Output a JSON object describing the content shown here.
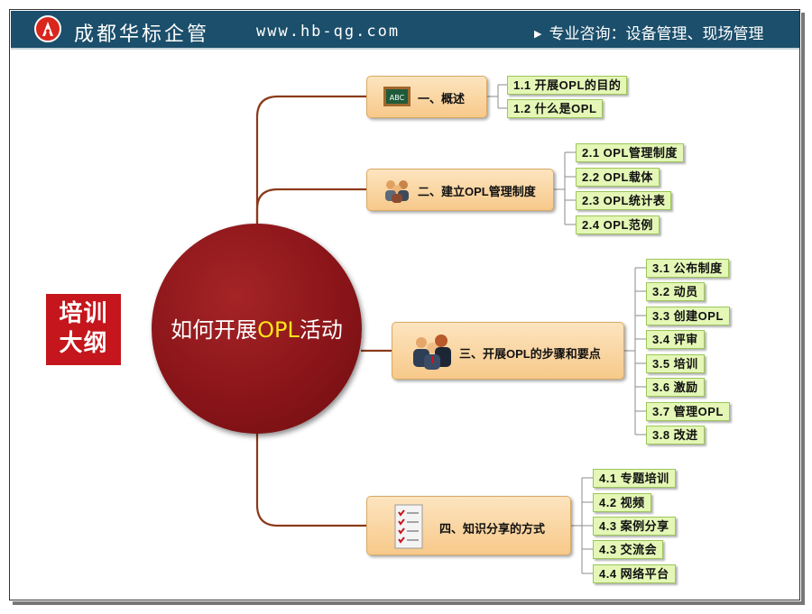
{
  "header": {
    "brand": "成都华标企管",
    "website": "www.hb-qg.com",
    "consult": "专业咨询：设备管理、现场管理"
  },
  "badge": {
    "line1": "培训",
    "line2": "大纲"
  },
  "center": {
    "title_prefix": "如何开展",
    "title_highlight": "OPL",
    "title_suffix": "活动"
  },
  "branches": [
    {
      "label": "一、概述",
      "icon": "abc-blackboard-icon",
      "items": [
        "1.1 开展OPL的目的",
        "1.2 什么是OPL"
      ]
    },
    {
      "label": "二、建立OPL管理制度",
      "icon": "team-icon",
      "items": [
        "2.1 OPL管理制度",
        "2.2 OPL载体",
        "2.3 OPL统计表",
        "2.4 OPL范例"
      ]
    },
    {
      "label": "三、开展OPL的步骤和要点",
      "icon": "business-people-icon",
      "items": [
        "3.1 公布制度",
        "3.2 动员",
        "3.3 创建OPL",
        "3.4 评审",
        "3.5 培训",
        "3.6 激励",
        "3.7 管理OPL",
        "3.8 改进"
      ]
    },
    {
      "label": "四、知识分享的方式",
      "icon": "checklist-icon",
      "items": [
        "4.1 专题培训",
        "4.2 视频",
        "4.3 案例分享",
        "4.3 交流会",
        "4.4 网络平台"
      ]
    }
  ],
  "colors": {
    "header_bg": "#1b4f6b",
    "center_fill": "#8a1519",
    "branch_fill": "#f9d6a3",
    "leaf_fill": "#e4f7b6",
    "badge_fill": "#c4161c",
    "connector": "#8b3a1a"
  }
}
